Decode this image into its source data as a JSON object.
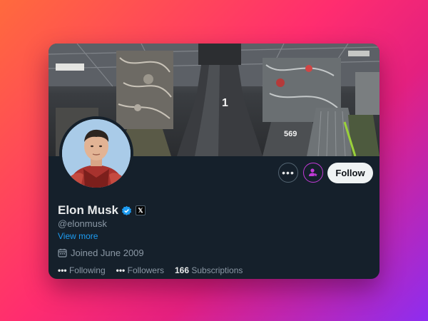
{
  "profile": {
    "name": "Elon Musk",
    "handle": "@elonmusk",
    "view_more": "View more",
    "joined": "Joined June 2009",
    "verified_color": "#1d9bf0",
    "affiliate_badge": "𝕏"
  },
  "actions": {
    "more_glyph": "•••",
    "follow_label": "Follow"
  },
  "stats": {
    "following_count": "•••",
    "following_label": "Following",
    "followers_count": "•••",
    "followers_label": "Followers",
    "subscriptions_count": "166",
    "subscriptions_label": "Subscriptions"
  },
  "banner": {
    "engine_number_center": "1",
    "engine_number_right": "569"
  },
  "colors": {
    "card_background": "#15202b",
    "text_primary": "#e7e9ea",
    "text_secondary": "#8b98a5",
    "link": "#1d9bf0",
    "subscribe_accent": "#c13ad6"
  }
}
